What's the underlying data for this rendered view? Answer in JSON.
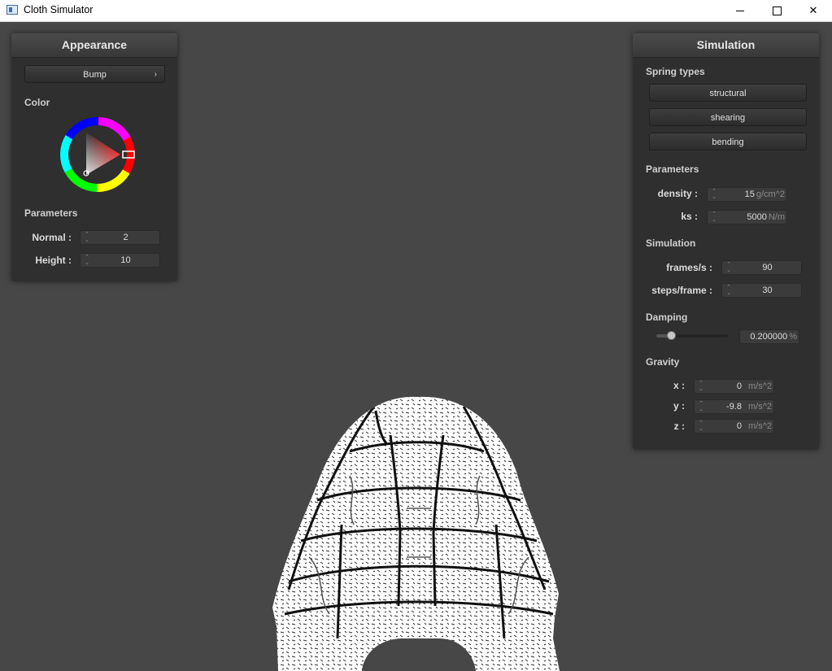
{
  "window": {
    "title": "Cloth Simulator"
  },
  "appearance": {
    "header": "Appearance",
    "shader_button": "Bump",
    "color_label": "Color",
    "parameters_label": "Parameters",
    "normal": {
      "label": "Normal :",
      "value": "2"
    },
    "height": {
      "label": "Height :",
      "value": "10"
    },
    "color_wheel": {
      "selected_hue": "#ff0000"
    }
  },
  "simulation": {
    "header": "Simulation",
    "spring_types_label": "Spring types",
    "spring_buttons": [
      "structural",
      "shearing",
      "bending"
    ],
    "parameters_label": "Parameters",
    "density": {
      "label": "density :",
      "value": "15",
      "unit": "g/cm^2"
    },
    "ks": {
      "label": "ks :",
      "value": "5000",
      "unit": "N/m"
    },
    "simulation_label": "Simulation",
    "frames": {
      "label": "frames/s :",
      "value": "90"
    },
    "steps": {
      "label": "steps/frame :",
      "value": "30"
    },
    "damping_label": "Damping",
    "damping": {
      "value": "0.200000",
      "unit": "%",
      "slider_fraction": 0.2
    },
    "gravity_label": "Gravity",
    "gravity": [
      {
        "label": "x :",
        "value": "0",
        "unit": "m/s^2"
      },
      {
        "label": "y :",
        "value": "-9.8",
        "unit": "m/s^2"
      },
      {
        "label": "z :",
        "value": "0",
        "unit": "m/s^2"
      }
    ]
  },
  "colors": {
    "background": "#474747",
    "panel": "#2f2f2f"
  }
}
